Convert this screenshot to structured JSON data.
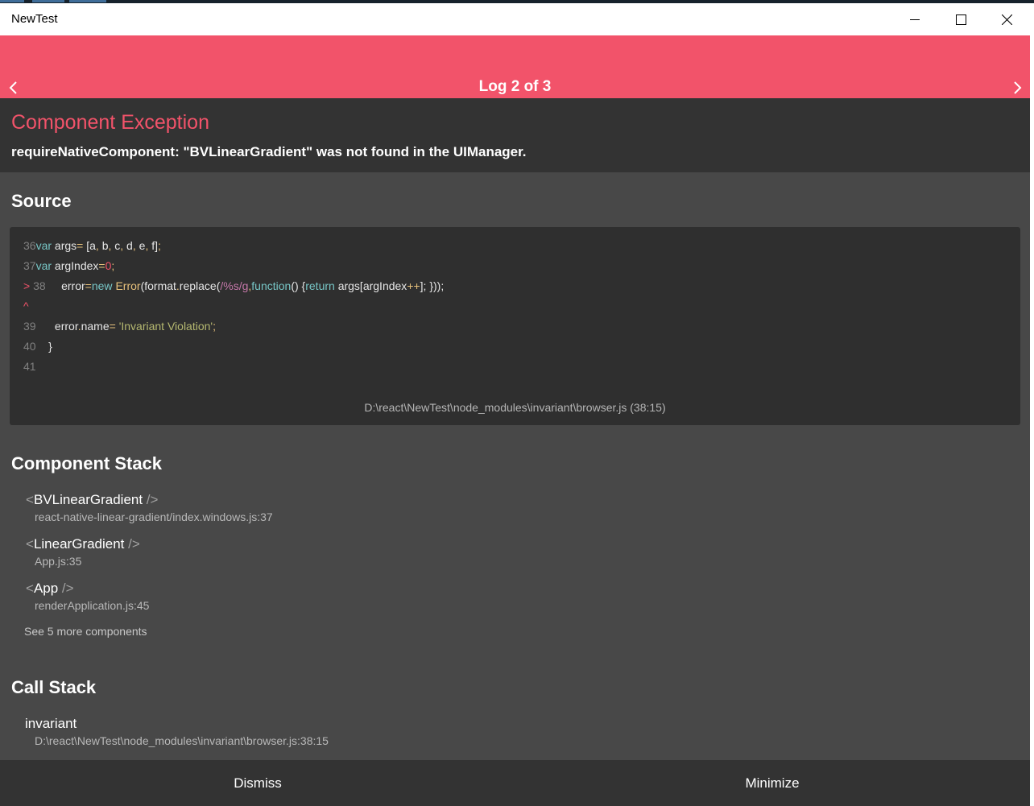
{
  "window": {
    "title": "NewTest"
  },
  "header": {
    "log_label": "Log 2 of 3"
  },
  "exception": {
    "title": "Component Exception",
    "message": "requireNativeComponent: \"BVLinearGradient\" was not found in the UIManager."
  },
  "source": {
    "section_title": "Source",
    "lines": [
      {
        "num": "36",
        "code": "var args = [a, b, c, d, e, f];"
      },
      {
        "num": "37",
        "code": "var argIndex = 0;"
      },
      {
        "num": "> 38",
        "code": "error = new Error(format.replace(/%s/g, function() {return args[argIndex++]; }));"
      },
      {
        "num": "^",
        "code": ""
      },
      {
        "num": "39",
        "code": "error.name = 'Invariant Violation';"
      },
      {
        "num": "40",
        "code": "}"
      },
      {
        "num": "41",
        "code": ""
      }
    ],
    "file": "D:\\react\\NewTest\\node_modules\\invariant\\browser.js (38:15)"
  },
  "component_stack": {
    "section_title": "Component Stack",
    "items": [
      {
        "name": "BVLinearGradient",
        "location": "react-native-linear-gradient/index.windows.js:37"
      },
      {
        "name": "LinearGradient",
        "location": "App.js:35"
      },
      {
        "name": "App",
        "location": "renderApplication.js:45"
      }
    ],
    "see_more": "See 5 more components"
  },
  "call_stack": {
    "section_title": "Call Stack",
    "items": [
      {
        "name": "invariant",
        "location": "D:\\react\\NewTest\\node_modules\\invariant\\browser.js:38:15"
      }
    ]
  },
  "footer": {
    "dismiss_label": "Dismiss",
    "minimize_label": "Minimize"
  },
  "colors": {
    "accent": "#f2536a",
    "panel_dark": "#333333",
    "background": "#484848"
  },
  "icons": [
    "minimize-icon",
    "maximize-icon",
    "close-icon",
    "chevron-left-icon",
    "chevron-right-icon"
  ]
}
